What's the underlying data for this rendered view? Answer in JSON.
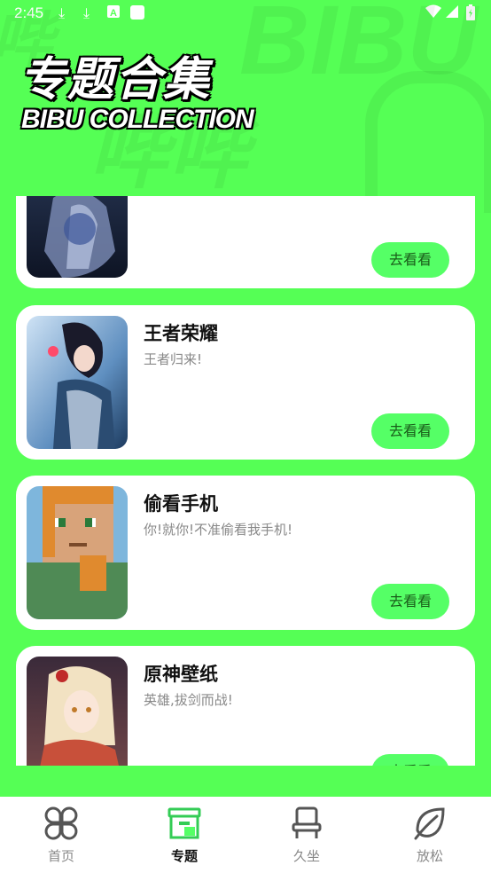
{
  "status_bar": {
    "time": "2:45",
    "icons": [
      "download-icon",
      "download-icon",
      "a-icon",
      "square-icon",
      "wifi-icon",
      "signal-icon",
      "battery-icon"
    ]
  },
  "header": {
    "title": "专题合集",
    "subtitle": "BIBU COLLECTION"
  },
  "cards": [
    {
      "title": "",
      "description": "",
      "button": "去看看"
    },
    {
      "title": "王者荣耀",
      "description": "王者归来!",
      "button": "去看看"
    },
    {
      "title": "偷看手机",
      "description": "你!就你!不准偷看我手机!",
      "button": "去看看"
    },
    {
      "title": "原神壁纸",
      "description": "英雄,拔剑而战!",
      "button": "去看看"
    }
  ],
  "bottom_nav": [
    {
      "label": "首页",
      "icon": "grid-petals-icon",
      "active": false
    },
    {
      "label": "专题",
      "icon": "archive-box-icon",
      "active": true
    },
    {
      "label": "久坐",
      "icon": "chair-icon",
      "active": false
    },
    {
      "label": "放松",
      "icon": "leaf-icon",
      "active": false
    }
  ],
  "colors": {
    "background": "#55ff55",
    "button": "#55ff66",
    "active_icon": "#33cc55"
  }
}
